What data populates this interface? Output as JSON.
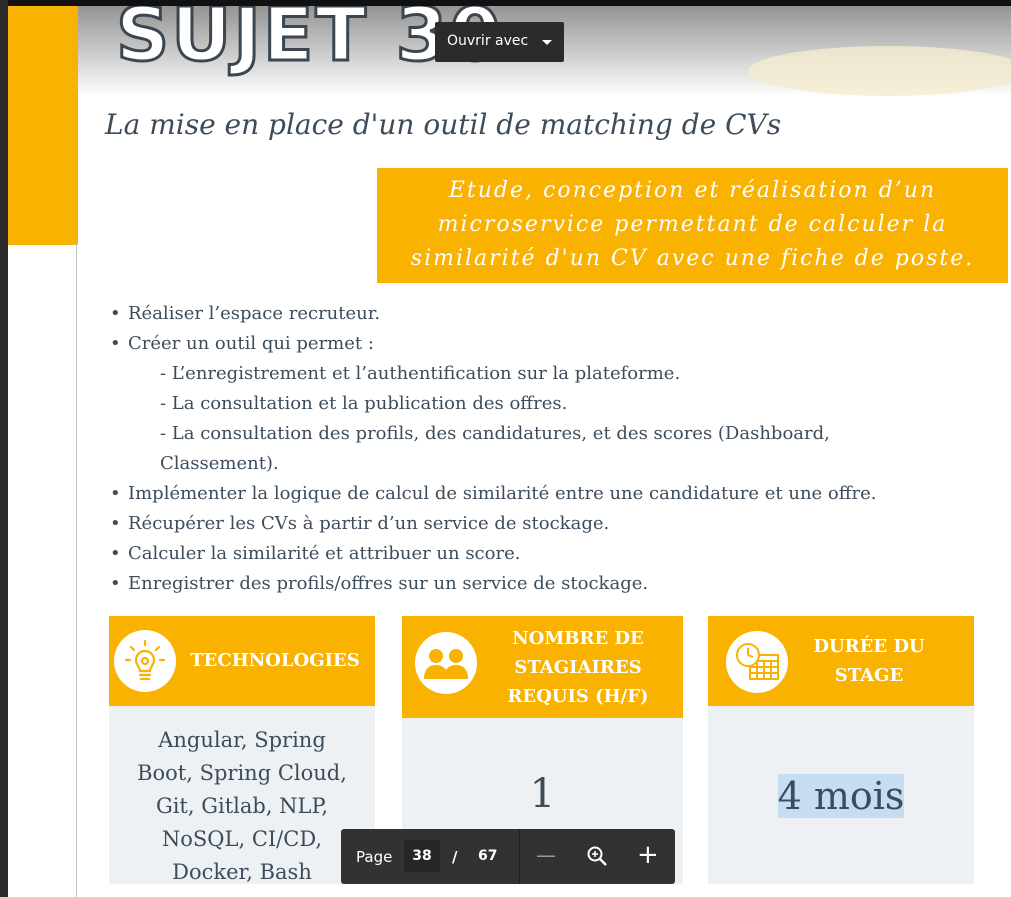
{
  "slide": {
    "heading": "SUJET 30",
    "subtitle": "La mise en place d'un outil de matching de CVs",
    "banner_lines": [
      "Etude, conception et réalisation d’un",
      "microservice permettant de calculer la",
      "similarité d'un CV avec une fiche de poste."
    ],
    "bullets": [
      "Réaliser l’espace recruteur.",
      "Créer un outil qui permet :",
      "- L’enregistrement et l’authentification sur la plateforme.",
      "- La consultation et la publication des offres.",
      "- La consultation des profils, des candidatures, et des scores (Dashboard,",
      "Classement).",
      "Implémenter la logique de calcul de similarité entre une candidature et une offre.",
      "Récupérer les CVs à partir d’un service de stockage.",
      "Calculer la similarité et attribuer un score.",
      "Enregistrer des profils/offres sur un service de stockage."
    ],
    "bullet_symbol": "•",
    "cards": {
      "technologies": {
        "title": "TECHNOLOGIES",
        "icon": "lightbulb-gear-icon",
        "body_lines": [
          "Angular, Spring",
          "Boot, Spring Cloud,",
          "Git, Gitlab, NLP,",
          "NoSQL, CI/CD,",
          "Docker, Bash"
        ]
      },
      "interns": {
        "title_lines": [
          "NOMBRE DE",
          "STAGIAIRES",
          "REQUIS (H/F)"
        ],
        "icon": "two-people-icon",
        "value": "1"
      },
      "duration": {
        "title_lines": [
          "DURÉE DU",
          "STAGE"
        ],
        "icon": "clock-calendar-icon",
        "value": "4 mois"
      }
    }
  },
  "viewer": {
    "open_with_label": "Ouvrir avec",
    "page_label": "Page",
    "current_page": "38",
    "separator": "/",
    "total_pages": "67",
    "zoom_out_symbol": "—",
    "zoom_in_symbol": "+",
    "zoom_icon": "zoom-magnifier-icon"
  },
  "colors": {
    "accent": "#f9b200",
    "text": "#3d4c5b",
    "card_bg": "#eef1f4",
    "toolbar_bg": "#323232",
    "selection": "#c6dcf3"
  }
}
